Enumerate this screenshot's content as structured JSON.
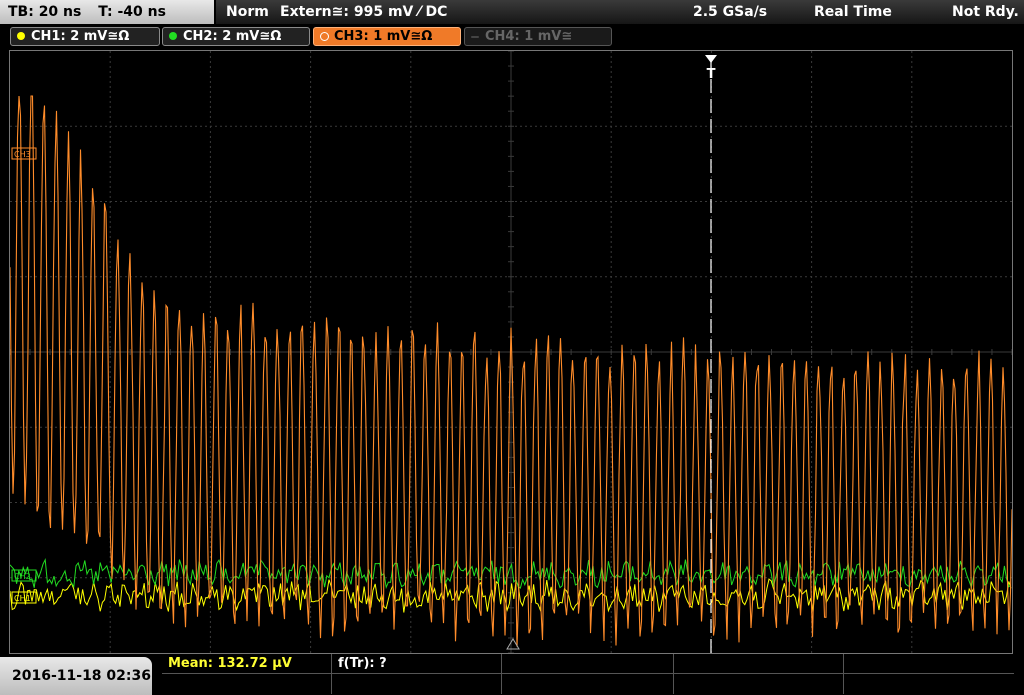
{
  "timebase": {
    "tb": "TB: 20 ns",
    "trig_time": "T: -40 ns"
  },
  "status": {
    "mode": "Norm",
    "trigger": "Extern≅: 995 mV ⁄ DC",
    "sample_rate": "2.5 GSa/s",
    "acq_mode": "Real Time",
    "state": "Not Rdy."
  },
  "channels": [
    {
      "label": "CH1: 2 mV≅Ω",
      "color": "#ffff00",
      "state": "on"
    },
    {
      "label": "CH2: 2 mV≅Ω",
      "color": "#22dd22",
      "state": "on"
    },
    {
      "label": "CH3: 1 mV≅Ω",
      "color": "#ff8c2a",
      "state": "selected"
    },
    {
      "label": "CH4: 1 mV≅",
      "color": "#666666",
      "state": "off"
    }
  ],
  "markers": {
    "ch3_marker": "CH3",
    "ch2_marker": "CH2",
    "ch1_marker": "CH1",
    "trigger_marker": "T"
  },
  "footer": {
    "datetime": "2016-11-18 02:36",
    "mean": "Mean: 132.72 µV",
    "freq": "f(Tr): ?"
  },
  "colors": {
    "grid": "#3a3a3a",
    "ch1": "#ffff00",
    "ch2": "#22dd22",
    "ch3": "#ff8c2a",
    "trigger": "#ffffff",
    "mean_text": "#ffff33"
  },
  "waveform": {
    "ch3_decay_start_mV": 1.0,
    "ch3_decay_end_mV": 0.3,
    "ch1_noise_level": "low",
    "ch2_noise_level": "low"
  }
}
